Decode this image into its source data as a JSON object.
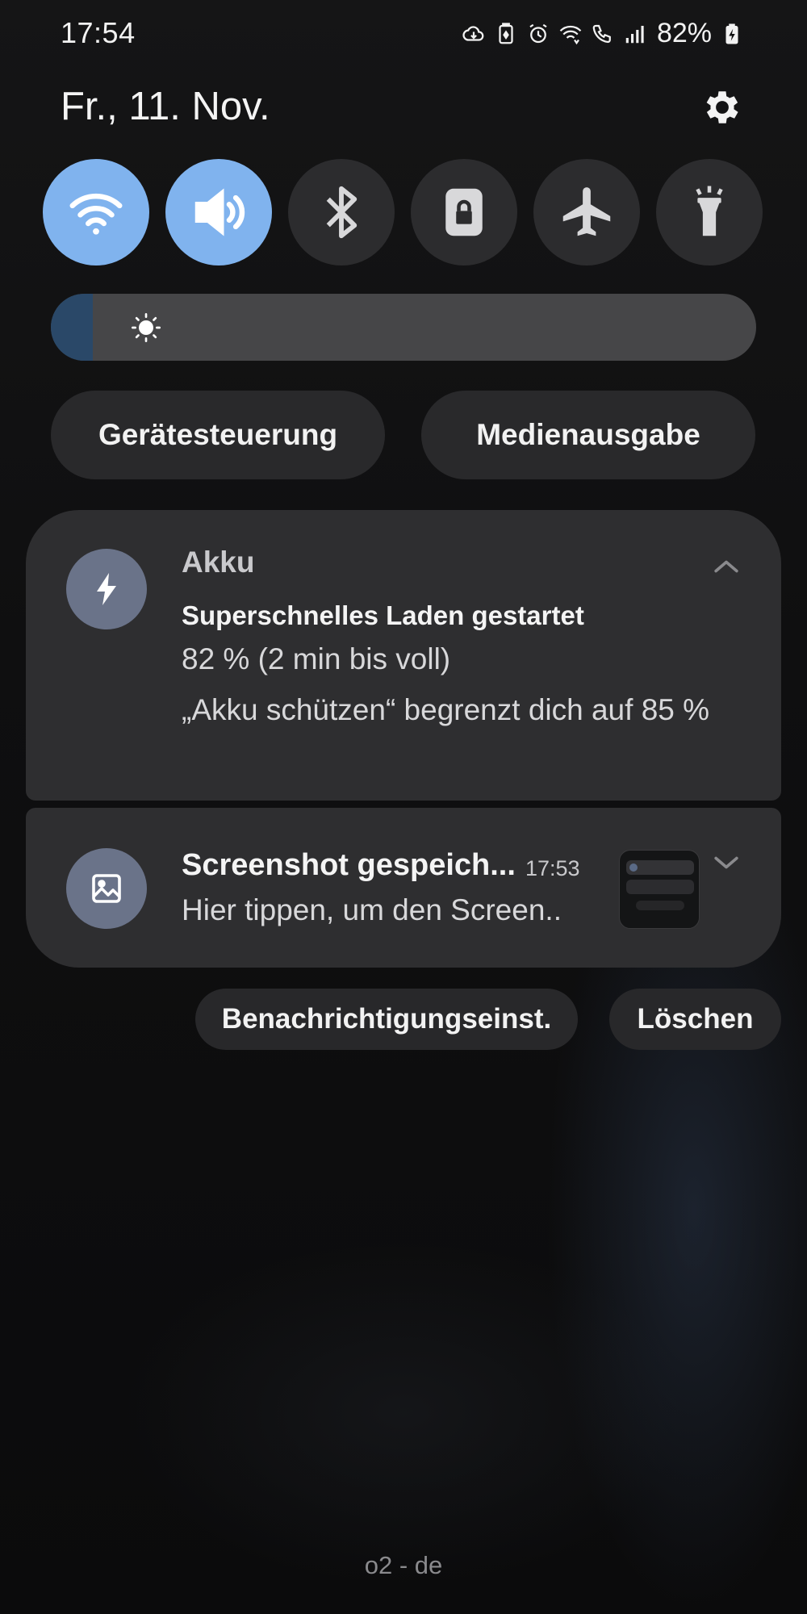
{
  "status_bar": {
    "time": "17:54",
    "battery_percent": "82%",
    "icons": [
      "cloud-sync-icon",
      "battery-saver-icon",
      "alarm-icon",
      "wifi-calling-icon",
      "volte-call-icon",
      "signal-icon",
      "battery-charging-icon"
    ]
  },
  "header": {
    "date": "Fr., 11. Nov.",
    "settings_icon": "gear-icon"
  },
  "quick_tiles": [
    {
      "name": "wifi",
      "icon": "wifi-icon",
      "active": true
    },
    {
      "name": "sound",
      "icon": "volume-icon",
      "active": true
    },
    {
      "name": "bluetooth",
      "icon": "bluetooth-icon",
      "active": false
    },
    {
      "name": "rotation-lock",
      "icon": "lock-icon",
      "active": false
    },
    {
      "name": "airplane-mode",
      "icon": "airplane-icon",
      "active": false
    },
    {
      "name": "flashlight",
      "icon": "flashlight-icon",
      "active": false
    }
  ],
  "brightness": {
    "level": 0.06,
    "icon": "sun-icon",
    "more_icon": "more-vertical-icon"
  },
  "pills": {
    "device_control": "Gerätesteuerung",
    "media_output": "Medienausgabe"
  },
  "notifications": {
    "battery": {
      "app": "Akku",
      "title": "Superschnelles Laden gestartet",
      "line1": "82 % (2 min bis voll)",
      "line2": "„Akku schützen“ begrenzt dich auf 85 %",
      "icon": "lightning-icon",
      "expand_icon": "chevron-up-icon"
    },
    "screenshot": {
      "title": "Screenshot gespeich...",
      "time": "17:53",
      "text": "Hier tippen, um den Screen..",
      "icon": "image-icon",
      "expand_icon": "chevron-down-icon"
    }
  },
  "actions": {
    "notification_settings": "Benachrichtigungseinst.",
    "clear": "Löschen"
  },
  "carrier": "o2 - de",
  "colors": {
    "accent": "#80b3ee",
    "tile_off": "#2c2c2e",
    "card": "#2e2e30",
    "app_icon": "#6a7389",
    "brightness_fill": "#2a4868"
  }
}
